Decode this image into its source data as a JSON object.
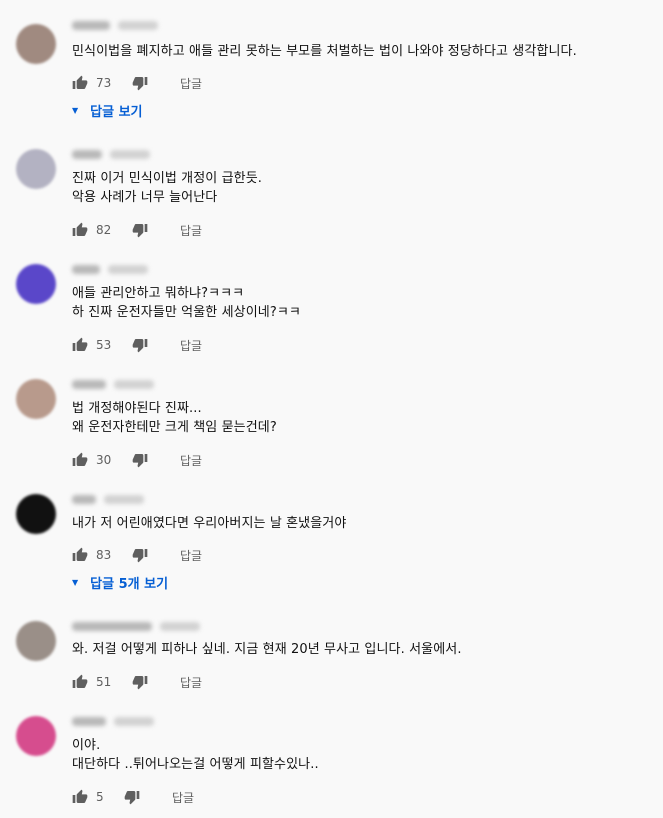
{
  "labels": {
    "reply": "답글"
  },
  "comments": [
    {
      "text": "민식이법을 폐지하고 애들 관리 못하는 부모를 처벌하는 법이 나와야 정당하다고 생각합니다.",
      "likes": "73",
      "replies_label": "답글 보기",
      "avatar_color": "#a08a80"
    },
    {
      "text": "진짜 이거 민식이법 개정이 급한듯.\n악용 사례가 너무 늘어난다",
      "likes": "82",
      "replies_label": "",
      "avatar_color": "#b3b2c2"
    },
    {
      "text": "애들 관리안하고 뭐하냐?ㅋㅋㅋ\n하 진짜 운전자들만 억울한 세상이네?ㅋㅋ",
      "likes": "53",
      "replies_label": "",
      "avatar_color": "#5a47c9"
    },
    {
      "text": "법 개정해야된다 진짜...\n왜 운전자한테만 크게 책임 묻는건데?",
      "likes": "30",
      "replies_label": "",
      "avatar_color": "#b89a8c"
    },
    {
      "text": "내가 저 어린애였다면 우리아버지는 날 혼냈을거야",
      "likes": "83",
      "replies_label": "답글 5개 보기",
      "avatar_color": "#111111"
    },
    {
      "text": "와. 저걸 어떻게 피하나 싶네. 지금 현재 20년 무사고 입니다. 서울에서.",
      "likes": "51",
      "replies_label": "",
      "avatar_color": "#9a8f88"
    },
    {
      "text": "이야.\n대단하다 ..튀어나오는걸 어떻게 피할수있나..",
      "likes": "5",
      "replies_label": "",
      "avatar_color": "#d64d8e"
    }
  ]
}
